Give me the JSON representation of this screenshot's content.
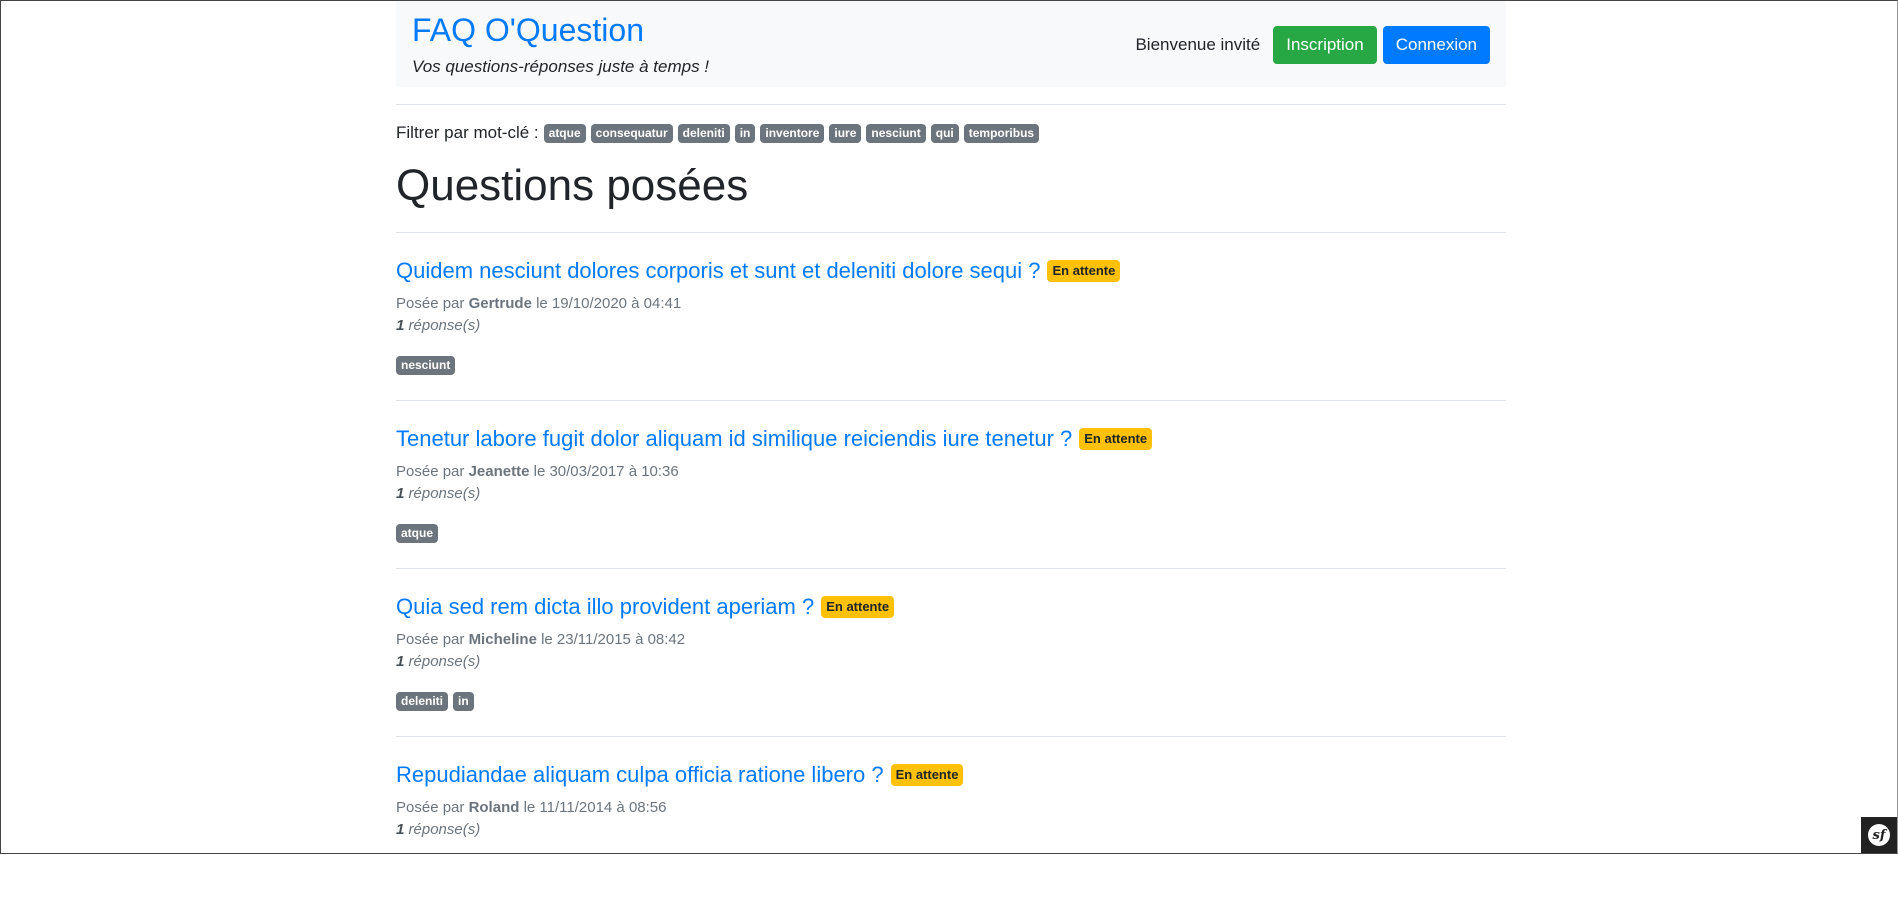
{
  "header": {
    "site_title": "FAQ O'Question",
    "tagline": "Vos questions-réponses juste à temps !",
    "welcome": "Bienvenue invité",
    "signup_label": "Inscription",
    "login_label": "Connexion"
  },
  "filter": {
    "label": "Filtrer par mot-clé :",
    "tags": [
      "atque",
      "consequatur",
      "deleniti",
      "in",
      "inventore",
      "iure",
      "nesciunt",
      "qui",
      "temporibus"
    ]
  },
  "page_title": "Questions posées",
  "questions": [
    {
      "title": "Quidem nesciunt dolores corporis et sunt et deleniti dolore sequi ?",
      "status": "En attente",
      "posted_prefix": "Posée par",
      "author": "Gertrude",
      "date": "le 19/10/2020 à 04:41",
      "answer_count": "1",
      "answer_label": "réponse(s)",
      "tags": [
        "nesciunt"
      ]
    },
    {
      "title": "Tenetur labore fugit dolor aliquam id similique reiciendis iure tenetur ?",
      "status": "En attente",
      "posted_prefix": "Posée par",
      "author": "Jeanette",
      "date": "le 30/03/2017 à 10:36",
      "answer_count": "1",
      "answer_label": "réponse(s)",
      "tags": [
        "atque"
      ]
    },
    {
      "title": "Quia sed rem dicta illo provident aperiam ?",
      "status": "En attente",
      "posted_prefix": "Posée par",
      "author": "Micheline",
      "date": "le 23/11/2015 à 08:42",
      "answer_count": "1",
      "answer_label": "réponse(s)",
      "tags": [
        "deleniti",
        "in"
      ]
    },
    {
      "title": "Repudiandae aliquam culpa officia ratione libero ?",
      "status": "En attente",
      "posted_prefix": "Posée par",
      "author": "Roland",
      "date": "le 11/11/2014 à 08:56",
      "answer_count": "1",
      "answer_label": "réponse(s)",
      "tags": []
    }
  ],
  "toolbar": {
    "logo_text": "sf"
  }
}
